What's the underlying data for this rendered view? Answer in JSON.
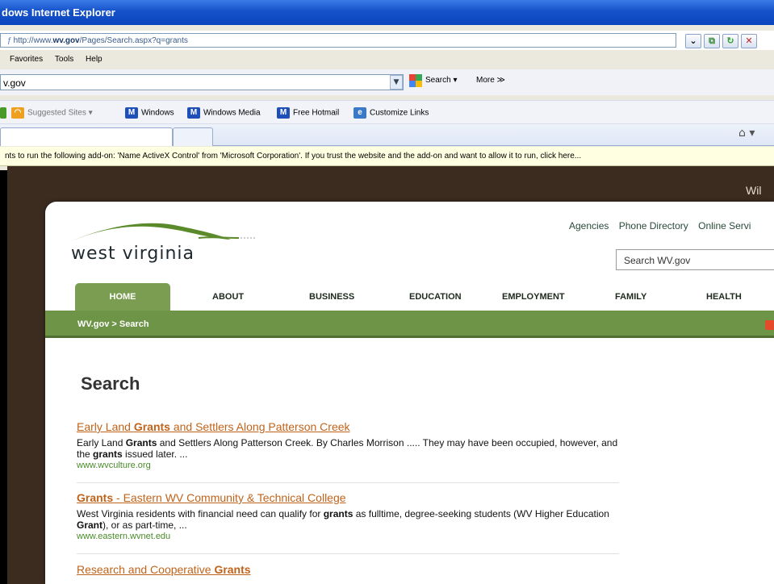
{
  "window": {
    "title": "dows Internet Explorer"
  },
  "address": {
    "prefix": "http://www.",
    "domain": "wv.gov",
    "path": "/Pages/Search.aspx?q=grants"
  },
  "menu": {
    "items": [
      "Favorites",
      "Tools",
      "Help"
    ]
  },
  "search_bar": {
    "value": "v.gov",
    "search_label": "Search ▾",
    "more_label": "More ≫"
  },
  "favorites": [
    {
      "label": "Suggested Sites ▾",
      "icon": "suggested-sites-icon"
    },
    {
      "label": "Windows",
      "icon": "msn-icon"
    },
    {
      "label": "Windows Media",
      "icon": "msn-icon"
    },
    {
      "label": "Free Hotmail",
      "icon": "msn-icon"
    },
    {
      "label": "Customize Links",
      "icon": "ie-icon"
    }
  ],
  "infobar": {
    "text": "nts to run the following add-on: 'Name ActiveX Control' from 'Microsoft Corporation'. If you trust the website and the add-on and want to allow it to run, click here..."
  },
  "site": {
    "welcome": "Wil",
    "logo_text": "west virginia",
    "top_links": [
      "Agencies",
      "Phone Directory",
      "Online Servi"
    ],
    "search_placeholder": "Search WV.gov",
    "nav": [
      "HOME",
      "ABOUT",
      "BUSINESS",
      "EDUCATION",
      "EMPLOYMENT",
      "FAMILY",
      "HEALTH"
    ],
    "breadcrumb": "WV.gov > Search"
  },
  "results": {
    "heading": "Search",
    "items": [
      {
        "title_before": "Early Land ",
        "title_bold": "Grants",
        "title_after": " and Settlers Along Patterson Creek",
        "snippet": "Early Land Grants and Settlers Along Patterson Creek. By Charles Morrison ..... They may have been occupied, however, and the grants issued later. ...",
        "url": "www.wvculture.org"
      },
      {
        "title_before": "",
        "title_bold": "Grants",
        "title_after": " - Eastern WV Community & Technical College",
        "snippet": "West Virginia residents with financial need can qualify for grants as fulltime, degree-seeking students (WV Higher Education Grant), or as part-time, ...",
        "url": "www.eastern.wvnet.edu"
      },
      {
        "title_before": "Research and Cooperative ",
        "title_bold": "Grants",
        "title_after": ""
      }
    ]
  },
  "colors": {
    "titlebar": "#0b45bd",
    "page_bg": "#3c2c20",
    "nav_green": "#6e9448",
    "link": "#c0631a",
    "url_green": "#4a8a2a"
  }
}
